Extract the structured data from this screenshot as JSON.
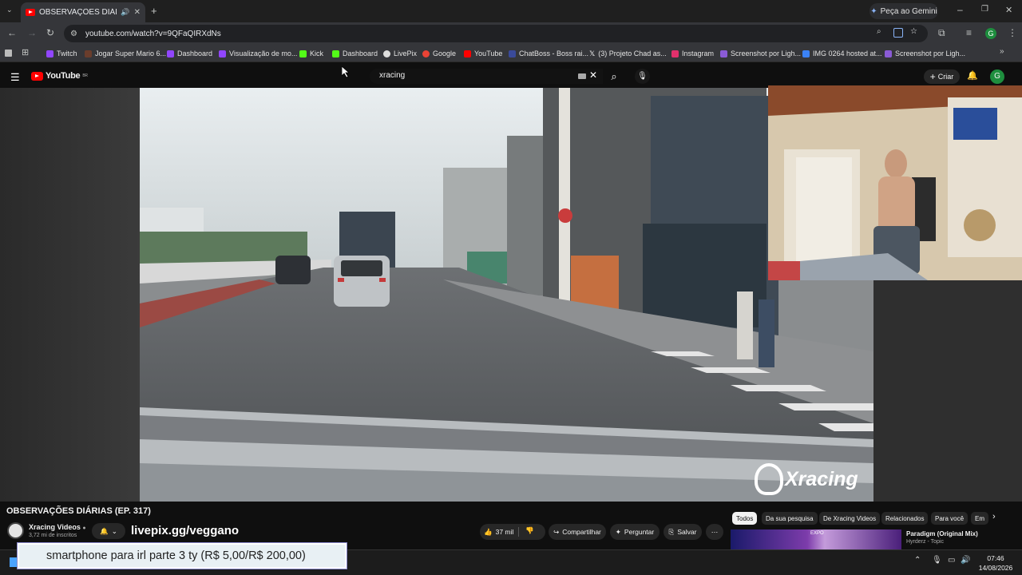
{
  "browser": {
    "tab_title": "OBSERVAÇÕES DIÁRIAS (EP. 317)",
    "gemini_label": "Peça ao Gemini",
    "url": "youtube.com/watch?v=9QFaQIRXdNs",
    "profile_initial": "G",
    "bookmarks": [
      {
        "label": "Twitch",
        "color": "#9146ff"
      },
      {
        "label": "Jogar Super Mario 6...",
        "color": "#6a3d2c"
      },
      {
        "label": "Dashboard",
        "color": "#9146ff"
      },
      {
        "label": "Visualização de mo...",
        "color": "#9146ff"
      },
      {
        "label": "Kick",
        "color": "#53fc18"
      },
      {
        "label": "Dashboard",
        "color": "#53fc18"
      },
      {
        "label": "LivePix",
        "color": "#dddddd"
      },
      {
        "label": "Google",
        "color": "#ea4335"
      },
      {
        "label": "YouTube",
        "color": "#ff0000"
      },
      {
        "label": "ChatBoss - Boss rai...",
        "color": "#3a4a9a"
      },
      {
        "label": "(3) Projeto Chad as...",
        "color": "#ffffff"
      },
      {
        "label": "Instagram",
        "color": "#e1306c"
      },
      {
        "label": "Screenshot por Ligh...",
        "color": "#8a5bd6"
      },
      {
        "label": "IMG 0264 hosted at...",
        "color": "#3b82f6"
      },
      {
        "label": "Screenshot por Ligh...",
        "color": "#8a5bd6"
      }
    ]
  },
  "youtube": {
    "logo_text": "YouTube",
    "logo_country": "BR",
    "search_query": "xracing",
    "create_label": "Criar",
    "avatar_initial": "G",
    "video_watermark": "Xracing",
    "video_title": "OBSERVAÇÕES DIÁRIAS (EP. 317)",
    "channel_name": "Xracing Videos",
    "subscribers": "3,72 mi de inscritos",
    "overlay_link": "livepix.gg/veggano",
    "likes": "37 mil",
    "share_label": "Compartilhar",
    "ask_label": "Perguntar",
    "save_label": "Salvar",
    "chips": [
      "Todos",
      "Da sua pesquisa",
      "De Xracing Videos",
      "Relacionados",
      "Para você",
      "Em"
    ],
    "related": {
      "title": "Paradigm (Original Mix)",
      "channel": "Hyrderz - Topic",
      "thumb_text": "EXPO"
    }
  },
  "alert_text": "smartphone para irl parte 3 ty (R$ 5,00/R$ 200,00)",
  "taskbar": {
    "time": "07:46",
    "date": "14/08/2026"
  }
}
